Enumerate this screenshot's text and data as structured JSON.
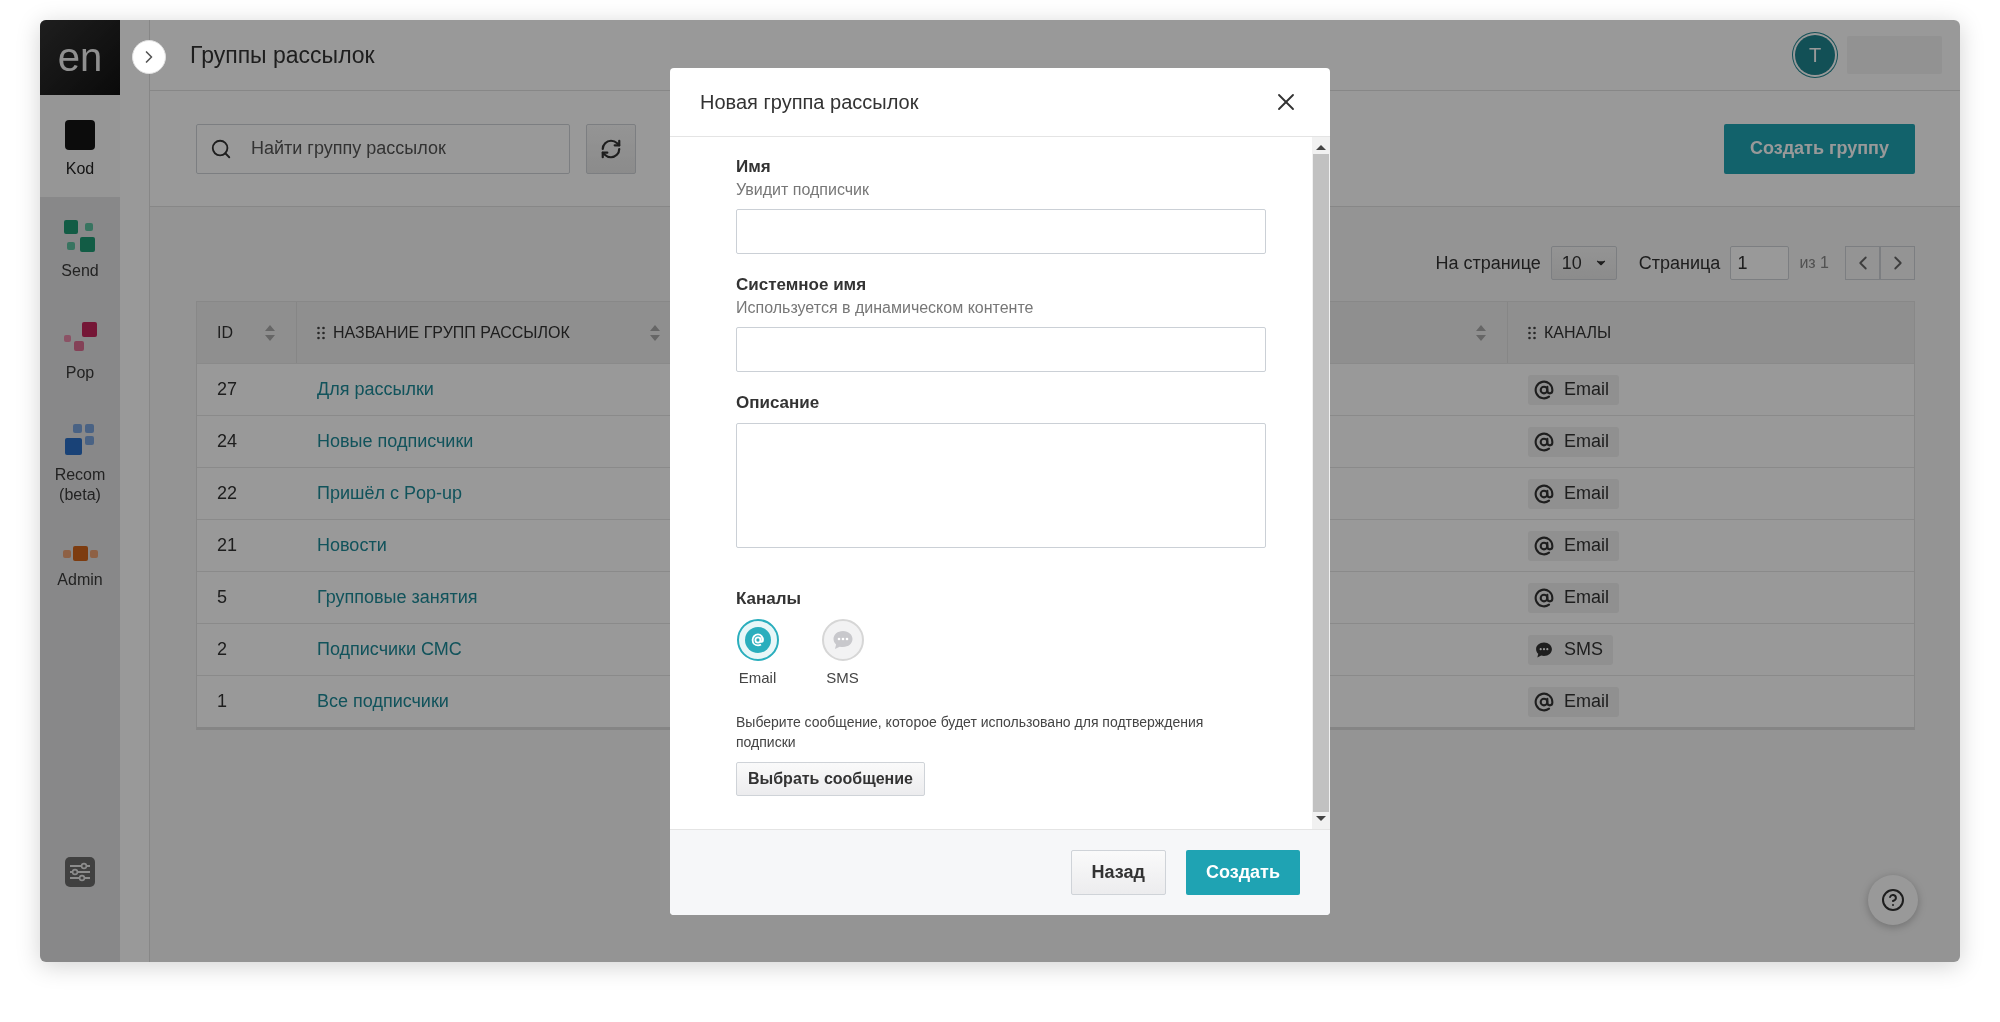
{
  "app": {
    "logo": "en",
    "page_title": "Группы рассылок",
    "user_initial": "T"
  },
  "sidebar": {
    "items": [
      {
        "label": "Kod",
        "kind": "kod",
        "selected": true
      },
      {
        "label": "Send",
        "kind": "send",
        "selected": false
      },
      {
        "label": "Pop",
        "kind": "pop",
        "selected": false
      },
      {
        "label": "Recom (beta)",
        "kind": "recom",
        "selected": false
      },
      {
        "label": "Admin",
        "kind": "admin",
        "selected": false
      }
    ]
  },
  "toolbar": {
    "search_placeholder": "Найти группу рассылок",
    "create_button": "Создать группу"
  },
  "pagination": {
    "per_page_label": "На странице",
    "per_page": "10",
    "page_label": "Страница",
    "page": "1",
    "total": "из 1"
  },
  "table": {
    "columns": [
      {
        "label": "ID",
        "sortable": true,
        "draggable": false
      },
      {
        "label": "НАЗВАНИЕ ГРУПП РАССЫЛОК",
        "sortable": true,
        "draggable": true
      },
      {
        "sortable": true,
        "draggable": false
      },
      {
        "label": "КАНАЛЫ",
        "sortable": false,
        "draggable": true
      }
    ],
    "rows": [
      {
        "id": "27",
        "name": "Для рассылки",
        "channel": {
          "kind": "email",
          "label": "Email"
        }
      },
      {
        "id": "24",
        "name": "Новые подписчики",
        "channel": {
          "kind": "email",
          "label": "Email"
        }
      },
      {
        "id": "22",
        "name": "Пришёл с Pop-up",
        "channel": {
          "kind": "email",
          "label": "Email"
        }
      },
      {
        "id": "21",
        "name": "Новости",
        "channel": {
          "kind": "email",
          "label": "Email"
        }
      },
      {
        "id": "5",
        "name": "Групповые занятия",
        "channel": {
          "kind": "email",
          "label": "Email"
        }
      },
      {
        "id": "2",
        "name": "Подписчики СМС",
        "channel": {
          "kind": "sms",
          "label": "SMS"
        }
      },
      {
        "id": "1",
        "name": "Все подписчики",
        "channel": {
          "kind": "email",
          "label": "Email"
        }
      }
    ]
  },
  "modal": {
    "title": "Новая группа рассылок",
    "fields": [
      {
        "label": "Имя",
        "hint": "Увидит подписчик",
        "kind": "input"
      },
      {
        "label": "Системное имя",
        "hint": "Используется в динамическом контенте",
        "kind": "input"
      },
      {
        "label": "Описание",
        "kind": "textarea"
      }
    ],
    "channels": {
      "label": "Каналы",
      "options": [
        {
          "label": "Email",
          "kind": "email",
          "selected": true
        },
        {
          "label": "SMS",
          "kind": "sms",
          "selected": false
        }
      ]
    },
    "confirm_text": "Выберите сообщение, которое будет использовано для подтверждения подписки",
    "choose_button": "Выбрать сообщение",
    "back_button": "Назад",
    "create_button": "Создать"
  }
}
